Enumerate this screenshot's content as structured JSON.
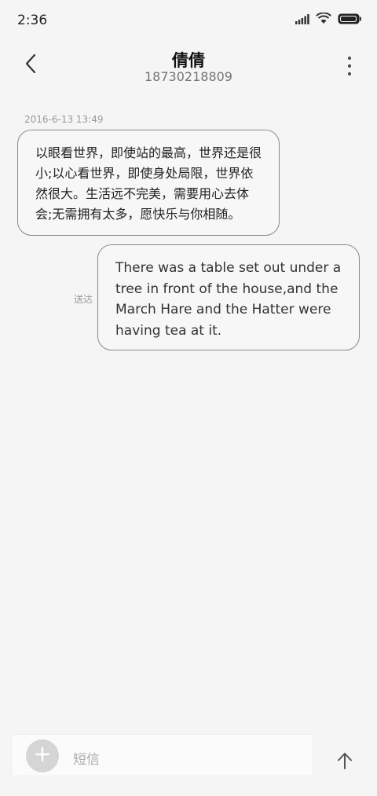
{
  "status_bar": {
    "time": "2:36",
    "icons": [
      "signal-icon",
      "wifi-icon",
      "battery-icon"
    ]
  },
  "header": {
    "contact_name": "倩倩",
    "phone_number": "18730218809",
    "icons": [
      "back-arrow-icon",
      "more-vertical-icon"
    ]
  },
  "conversation": {
    "timestamp": "2016-6-13 13:49",
    "incoming_message": "以眼看世界，即使站的最高，世界还是很小;以心看世界，即使身处局限，世界依然很大。生活远不完美，需要用心去体会;无需拥有太多，愿快乐与你相随。",
    "outgoing_message": "There was a table set out under a tree in front of the house,and the March Hare and the Hatter were having tea at it.",
    "outgoing_status": "送达"
  },
  "composer": {
    "placeholder": "短信",
    "icons": [
      "add-icon",
      "send-arrow-icon"
    ]
  },
  "colors": {
    "background": "#f5f5f5",
    "bubble_border": "#8a8a8a",
    "secondary_text": "#999999"
  }
}
